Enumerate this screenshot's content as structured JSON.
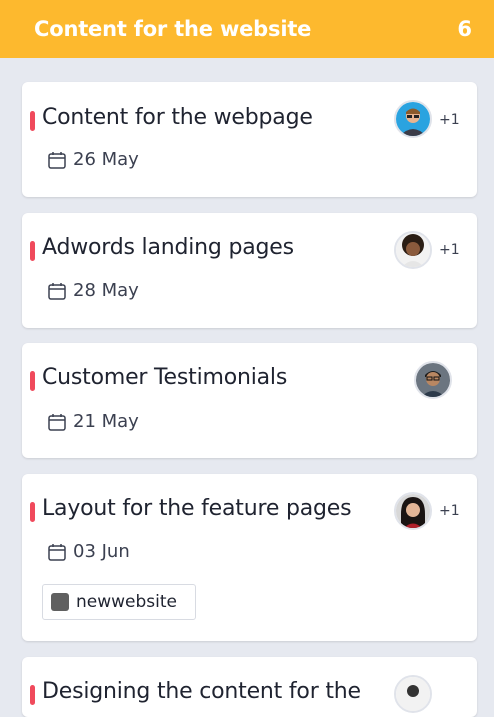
{
  "column": {
    "title": "Content for the website",
    "count": "6",
    "color": "#fdb92e"
  },
  "priority_color": "#f04a5c",
  "cards": [
    {
      "title": "Content for the webpage",
      "date": "26 May",
      "assignee_extra": "+1",
      "avatar": "man-sunglasses-blue-background-avatar"
    },
    {
      "title": "Adwords landing pages",
      "date": "28 May",
      "assignee_extra": "+1",
      "avatar": "woman-curly-hair-avatar"
    },
    {
      "title": "Customer Testimonials",
      "date": "21 May",
      "avatar": "man-glasses-avatar"
    },
    {
      "title": "Layout for the feature pages",
      "date": "03 Jun",
      "assignee_extra": "+1",
      "avatar": "woman-dark-hair-avatar",
      "tag": {
        "label": "newwebsite",
        "color": "#606060"
      }
    },
    {
      "title": "Designing the content for the",
      "avatar": "person-avatar"
    }
  ]
}
